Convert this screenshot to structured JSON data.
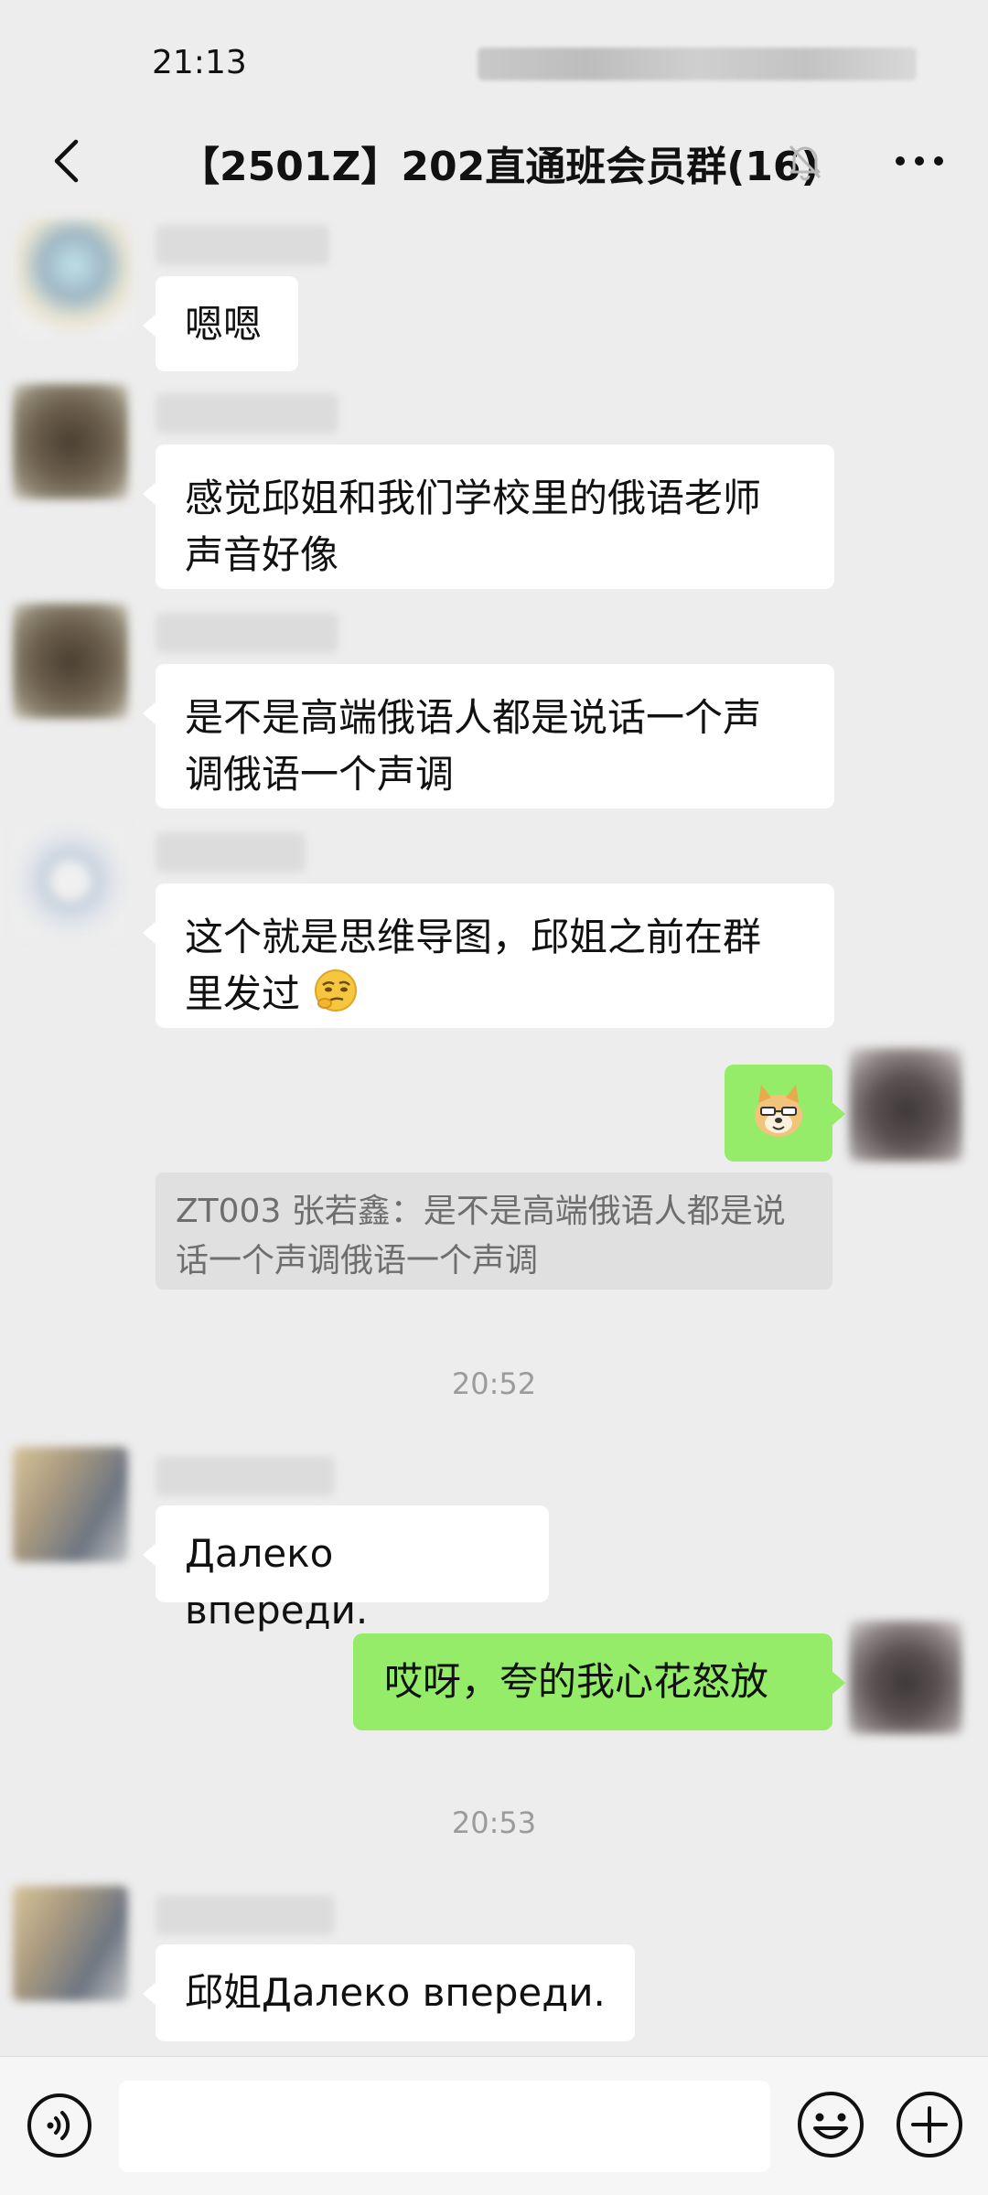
{
  "status_bar": {
    "time": "21:13"
  },
  "header": {
    "title": "【2501Z】202直通班会员群(16)"
  },
  "messages": [
    {
      "text": "嗯嗯"
    },
    {
      "line1": "感觉邱姐和我们学校里的俄语老师",
      "line2": "声音好像"
    },
    {
      "line1": "是不是高端俄语人都是说话一个声",
      "line2": "调俄语一个声调"
    },
    {
      "line1": "这个就是思维导图，邱姐之前在群",
      "line2": "里发过"
    },
    {
      "quote_line1": "ZT003 张若鑫：是不是高端俄语人都是说",
      "quote_line2": "话一个声调俄语一个声调"
    },
    {
      "time": "20:52"
    },
    {
      "text": "Далеко впереди."
    },
    {
      "text": "哎呀，夸的我心花怒放"
    },
    {
      "time": "20:53"
    },
    {
      "text": "邱姐Далеко впереди."
    }
  ],
  "input": {
    "placeholder": ""
  },
  "colors": {
    "background": "#ededed",
    "incoming_bubble": "#ffffff",
    "outgoing_bubble": "#95ec69",
    "timestamp": "#9b9b9b"
  },
  "icons": [
    "back-arrow-icon",
    "mute-bell-icon",
    "more-dots-icon",
    "voice-icon",
    "emoji-face-icon",
    "plus-icon",
    "thinking-face-emoji",
    "doge-sticker"
  ]
}
